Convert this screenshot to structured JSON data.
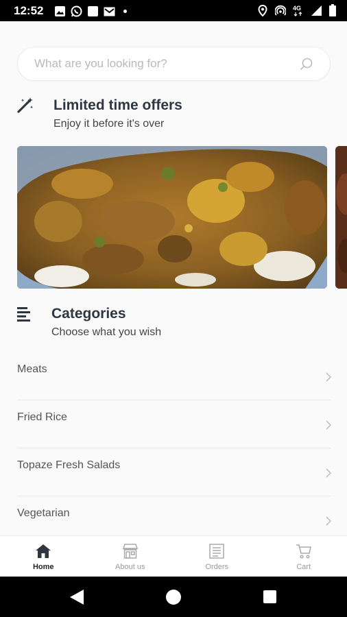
{
  "status_bar": {
    "time": "12:52",
    "left_icons": [
      "image-icon",
      "whatsapp-icon",
      "notification-square-icon",
      "gmail-icon",
      "dot-icon"
    ],
    "right_icons": [
      "location-icon",
      "hotspot-icon",
      "4g-icon",
      "signal-icon",
      "battery-icon"
    ],
    "network": "4G"
  },
  "search": {
    "placeholder": "What are you looking for?",
    "value": ""
  },
  "offers": {
    "title": "Limited time offers",
    "subtitle": "Enjoy it before it's over",
    "icon": "magic-wand-icon"
  },
  "categories": {
    "title": "Categories",
    "subtitle": "Choose what you wish",
    "icon": "list-icon",
    "items": [
      {
        "label": "Meats"
      },
      {
        "label": "Fried Rice"
      },
      {
        "label": "Topaze Fresh Salads"
      },
      {
        "label": "Vegetarian"
      }
    ]
  },
  "bottom_nav": {
    "items": [
      {
        "label": "Home",
        "icon": "home-icon",
        "active": true
      },
      {
        "label": "About us",
        "icon": "store-icon",
        "active": false
      },
      {
        "label": "Orders",
        "icon": "orders-icon",
        "active": false
      },
      {
        "label": "Cart",
        "icon": "cart-icon",
        "active": false
      }
    ]
  },
  "colors": {
    "accent_dark": "#2f3642",
    "background": "#fafafa",
    "inactive": "#9a9a9a"
  }
}
